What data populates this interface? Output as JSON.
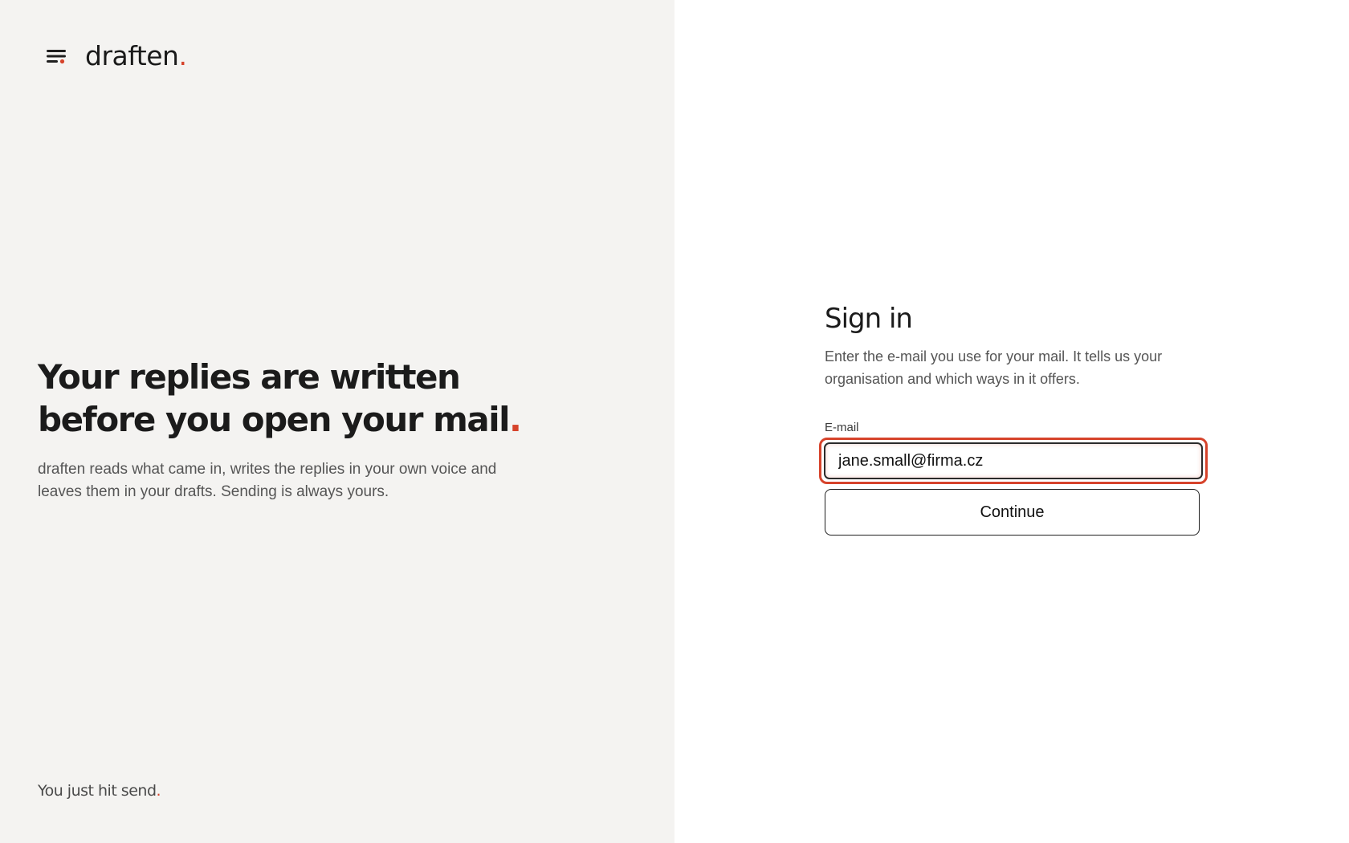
{
  "brand": {
    "icon": "menu-lines-icon",
    "name": "draften",
    "dot": "."
  },
  "hero": {
    "title": "Your replies are written before you open your mail",
    "title_dot": ".",
    "subtitle": "draften reads what came in, writes the replies in your own voice and leaves them in your drafts. Sending is always yours."
  },
  "tagline": {
    "text": "You just hit send",
    "dot": "."
  },
  "signin": {
    "title": "Sign in",
    "description": "Enter the e-mail you use for your mail. It tells us your organisation and which ways in it offers.",
    "email_label": "E-mail",
    "email_value": "jane.small@firma.cz",
    "continue_label": "Continue"
  },
  "colors": {
    "accent": "#d6432b",
    "left_bg": "#f4f3f1",
    "right_bg": "#ffffff"
  }
}
